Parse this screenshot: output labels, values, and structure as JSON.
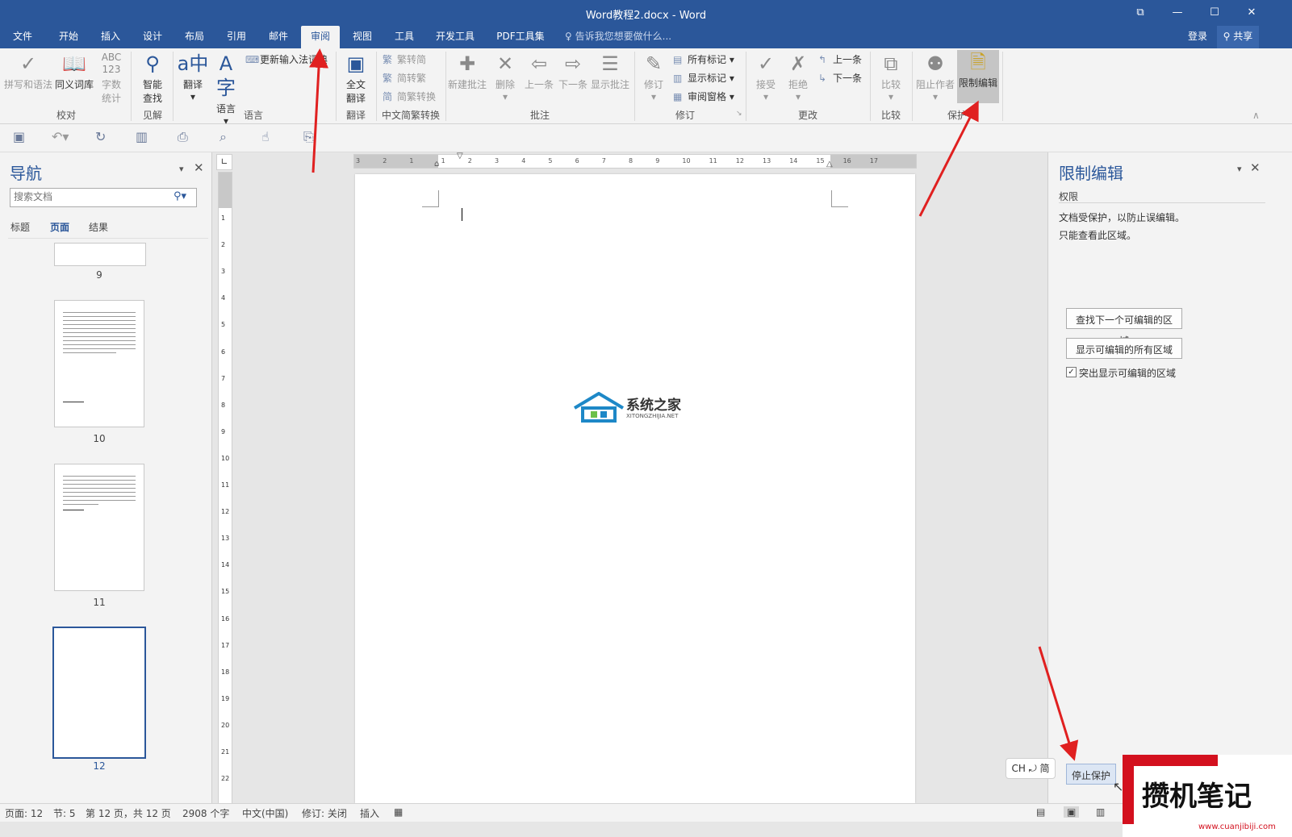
{
  "window": {
    "title": "Word教程2.docx - Word",
    "controls": [
      "⧉",
      "—",
      "☐",
      "✕"
    ]
  },
  "tabs": [
    {
      "label": "文件",
      "active": false
    },
    {
      "label": "开始",
      "active": false
    },
    {
      "label": "插入",
      "active": false
    },
    {
      "label": "设计",
      "active": false
    },
    {
      "label": "布局",
      "active": false
    },
    {
      "label": "引用",
      "active": false
    },
    {
      "label": "邮件",
      "active": false
    },
    {
      "label": "审阅",
      "active": true
    },
    {
      "label": "视图",
      "active": false
    },
    {
      "label": "工具",
      "active": false
    },
    {
      "label": "开发工具",
      "active": false
    },
    {
      "label": "PDF工具集",
      "active": false
    }
  ],
  "tell_me": "告诉我您想要做什么...",
  "account": {
    "login": "登录",
    "share": "共享"
  },
  "ribbon": {
    "proofing": {
      "spelling": "拼写和语法",
      "thesaurus": "同义词库",
      "word_count_1": "字数",
      "word_count_2": "统计",
      "group": "校对"
    },
    "insights": {
      "smart_lookup_1": "智能",
      "smart_lookup_2": "查找",
      "group": "见解"
    },
    "language": {
      "translate": "翻译",
      "language": "语言",
      "update_ime": "更新输入法词典",
      "group": "语言"
    },
    "translation": {
      "full_1": "全文",
      "full_2": "翻译",
      "group": "翻译"
    },
    "chinese": {
      "to_simplified": "繁转简",
      "to_traditional": "简转繁",
      "convert": "简繁转换",
      "group": "中文简繁转换"
    },
    "comments": {
      "new": "新建批注",
      "delete": "删除",
      "prev": "上一条",
      "next": "下一条",
      "show": "显示批注",
      "group": "批注"
    },
    "tracking": {
      "track": "修订",
      "all_markup": "所有标记",
      "show_markup": "显示标记",
      "reviewing_pane": "审阅窗格",
      "group": "修订"
    },
    "changes": {
      "accept": "接受",
      "reject": "拒绝",
      "prev": "上一条",
      "next": "下一条",
      "group": "更改"
    },
    "compare": {
      "compare": "比较",
      "group": "比较"
    },
    "protect": {
      "block_authors": "阻止作者",
      "restrict": "限制编辑",
      "group": "保护"
    }
  },
  "navigation": {
    "title": "导航",
    "search_placeholder": "搜索文档",
    "tabs": [
      "标题",
      "页面",
      "结果"
    ],
    "active_tab": "页面",
    "pages": [
      "9",
      "10",
      "11",
      "12"
    ],
    "current_page": "12"
  },
  "ruler": {
    "labels": [
      "3",
      "2",
      "1",
      "1",
      "2",
      "3",
      "4",
      "5",
      "6",
      "7",
      "8",
      "9",
      "10",
      "11",
      "12",
      "13",
      "14",
      "15",
      "16",
      "17"
    ],
    "vlabels": [
      "1",
      "2",
      "3",
      "4",
      "5",
      "6",
      "7",
      "8",
      "9",
      "10",
      "11",
      "12",
      "13",
      "14",
      "15",
      "16",
      "17",
      "18",
      "19",
      "20",
      "21",
      "22"
    ]
  },
  "watermark": {
    "name": "系统之家",
    "url": "XITONGZHIJIA.NET"
  },
  "restrict_pane": {
    "title": "限制编辑",
    "section": "权限",
    "message_1": "文档受保护，以防止误编辑。",
    "message_2": "只能查看此区域。",
    "find_next": "查找下一个可编辑的区域",
    "show_all": "显示可编辑的所有区域",
    "highlight_label": "突出显示可编辑的区域",
    "highlight_checked": true,
    "stop_protection": "停止保护"
  },
  "ime": "CH ⤾ 简",
  "status": {
    "page": "页面: 12",
    "section": "节: 5",
    "page_of": "第 12 页，共 12 页",
    "words": "2908 个字",
    "language": "中文(中国)",
    "track": "修订: 关闭",
    "mode": "插入"
  },
  "corner_logo": {
    "text": "攒机笔记",
    "url": "www.cuanjibiji.com"
  },
  "colors": {
    "accent": "#2b579a",
    "arrow": "#e02020"
  }
}
